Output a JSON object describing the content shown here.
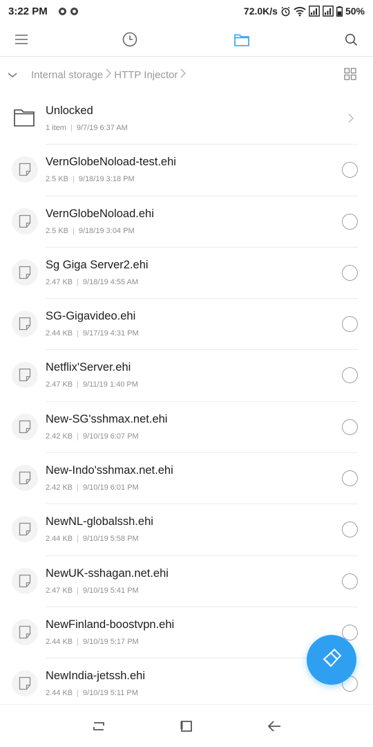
{
  "status_bar": {
    "time": "3:22 PM",
    "net_speed": "72.0K/s",
    "battery": "50%",
    "icons": [
      "notification-icon",
      "notification-icon",
      "alarm-icon",
      "wifi-icon",
      "signal-icon",
      "signal-icon",
      "battery-icon"
    ]
  },
  "toolbar": {
    "icons": [
      "menu-icon",
      "recent-clock-icon",
      "folder-icon",
      "search-icon"
    ],
    "active_tab": "folder-icon",
    "accent_color": "#2f9ff2"
  },
  "breadcrumb": {
    "segments": [
      "Internal storage",
      "HTTP Injector"
    ]
  },
  "folder": {
    "name": "Unlocked",
    "count": "1 item",
    "date": "9/7/19 6:37 AM"
  },
  "files": [
    {
      "name": "VernGlobeNoload-test.ehi",
      "size": "2.5 KB",
      "date": "9/18/19 3:18 PM"
    },
    {
      "name": "VernGlobeNoload.ehi",
      "size": "2.5 KB",
      "date": "9/18/19 3:04 PM"
    },
    {
      "name": "Sg Giga Server2.ehi",
      "size": "2.47 KB",
      "date": "9/18/19 4:55 AM"
    },
    {
      "name": "SG-Gigavideo.ehi",
      "size": "2.44 KB",
      "date": "9/17/19 4:31 PM"
    },
    {
      "name": "Netflix'Server.ehi",
      "size": "2.47 KB",
      "date": "9/11/19 1:40 PM"
    },
    {
      "name": "New-SG'sshmax.net.ehi",
      "size": "2.42 KB",
      "date": "9/10/19 6:07 PM"
    },
    {
      "name": "New-Indo'sshmax.net.ehi",
      "size": "2.42 KB",
      "date": "9/10/19 6:01 PM"
    },
    {
      "name": "NewNL-globalssh.ehi",
      "size": "2.44 KB",
      "date": "9/10/19 5:58 PM"
    },
    {
      "name": "NewUK-sshagan.net.ehi",
      "size": "2.47 KB",
      "date": "9/10/19 5:41 PM"
    },
    {
      "name": "NewFinland-boostvpn.ehi",
      "size": "2.44 KB",
      "date": "9/10/19 5:17 PM"
    },
    {
      "name": "NewIndia-jetssh.ehi",
      "size": "2.44 KB",
      "date": "9/10/19 5:11 PM"
    }
  ],
  "fab": {
    "icon": "clean-brush-icon"
  },
  "nav_bar": {
    "icons": [
      "recents-nav-icon",
      "home-nav-icon",
      "back-nav-icon"
    ]
  }
}
